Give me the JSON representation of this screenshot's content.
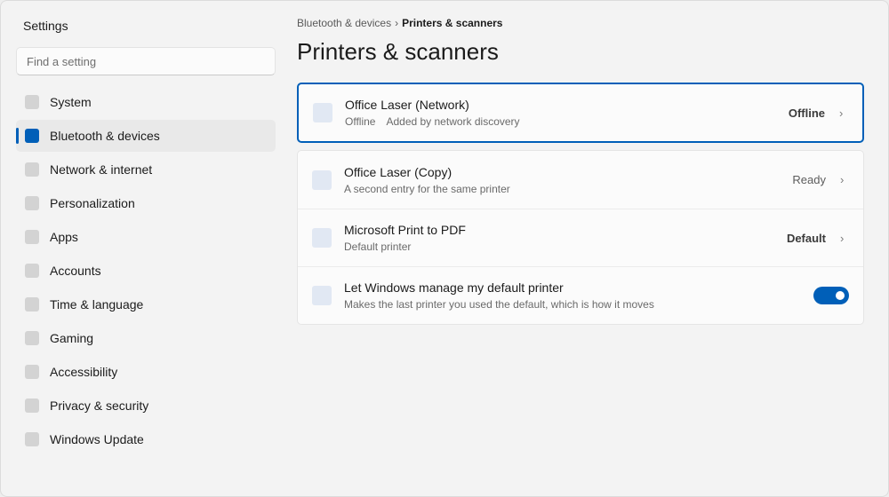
{
  "app": {
    "title": "Settings"
  },
  "search": {
    "placeholder": "Find a setting",
    "value": ""
  },
  "sidebar": {
    "items": [
      {
        "label": "System",
        "active": false
      },
      {
        "label": "Bluetooth & devices",
        "active": true
      },
      {
        "label": "Network & internet",
        "active": false
      },
      {
        "label": "Personalization",
        "active": false
      },
      {
        "label": "Apps",
        "active": false
      },
      {
        "label": "Accounts",
        "active": false
      },
      {
        "label": "Time & language",
        "active": false
      },
      {
        "label": "Gaming",
        "active": false
      },
      {
        "label": "Accessibility",
        "active": false
      },
      {
        "label": "Privacy & security",
        "active": false
      },
      {
        "label": "Windows Update",
        "active": false
      }
    ]
  },
  "breadcrumb": {
    "parent": "Bluetooth & devices",
    "separator": "›",
    "current": "Printers & scanners"
  },
  "page": {
    "title": "Printers & scanners"
  },
  "printers": {
    "focused": {
      "title": "Office Laser (Network)",
      "sub_a": "Offline",
      "sub_b": "Added by network discovery",
      "status": "Offline",
      "chevron": "›"
    },
    "copy": {
      "title": "Office Laser (Copy)",
      "sub": "A second entry for the same printer",
      "status": "Ready",
      "chevron": "›"
    },
    "pdf": {
      "title": "Microsoft Print to PDF",
      "sub": "Default printer",
      "status": "Default",
      "chevron": "›"
    },
    "manage_default": {
      "title": "Let Windows manage my default printer",
      "sub": "Makes the last printer you used the default, which is how it moves",
      "toggle_on": true
    }
  },
  "colors": {
    "accent": "#005fb8",
    "nav_icon": "#d3d3d3",
    "row_icon": "#e1e8f3"
  },
  "icons": {
    "nav": "square-icon",
    "row": "printer-icon",
    "chevron": "chevron-right-icon"
  }
}
